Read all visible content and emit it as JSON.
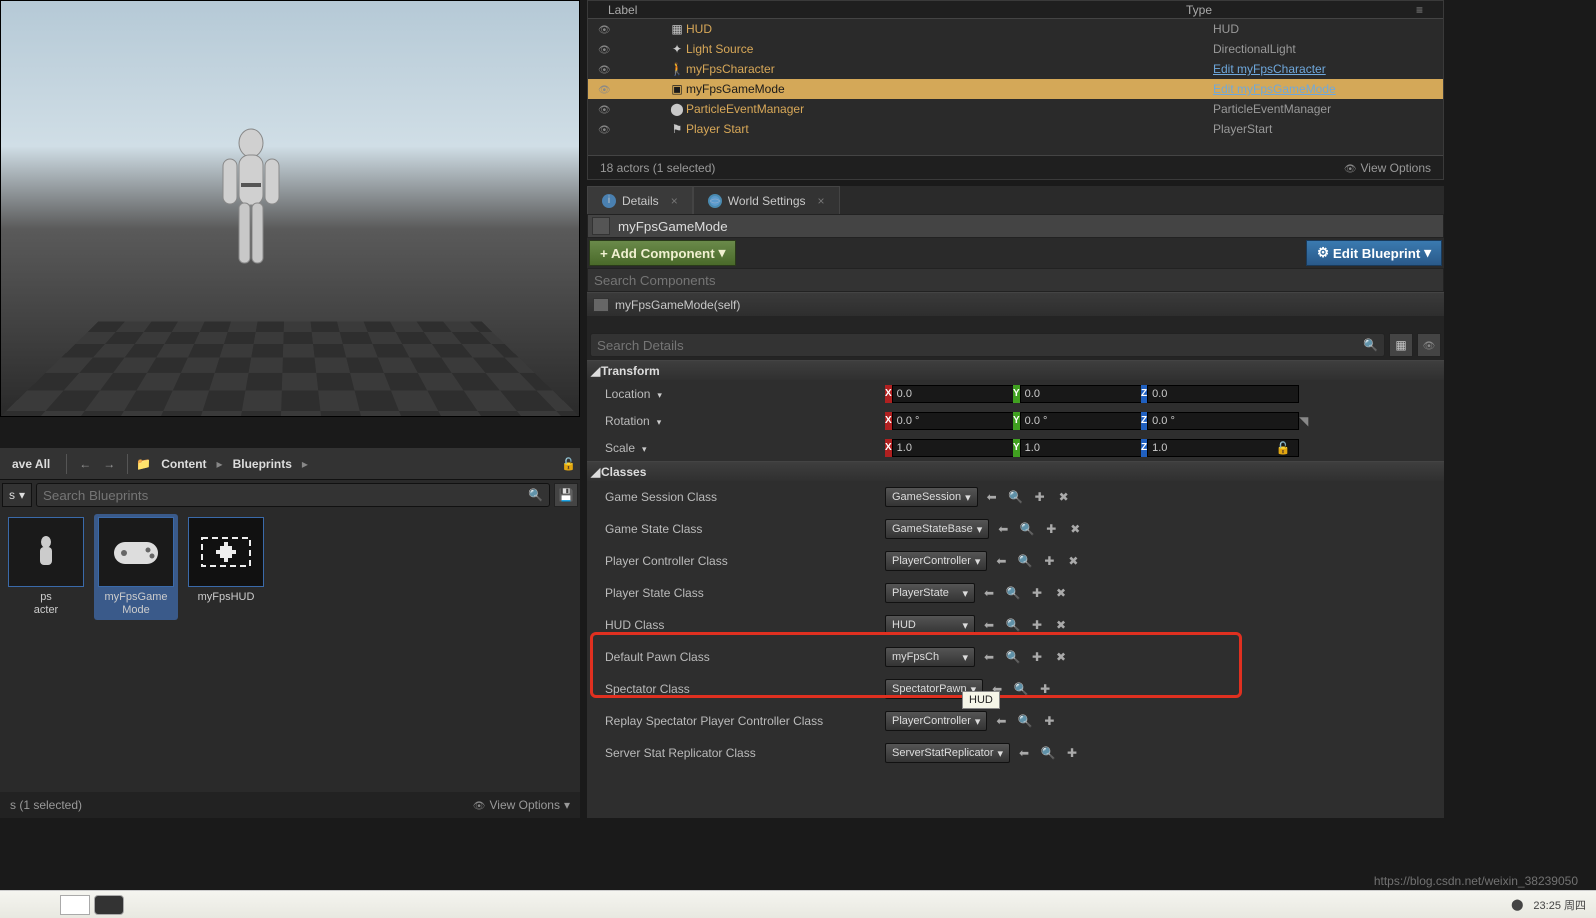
{
  "outliner": {
    "headers": {
      "label": "Label",
      "type": "Type"
    },
    "rows": [
      {
        "label": "HUD",
        "type": "HUD",
        "icon": "hud"
      },
      {
        "label": "Light Source",
        "type": "DirectionalLight",
        "icon": "light"
      },
      {
        "label": "myFpsCharacter",
        "type": "Edit myFpsCharacter",
        "icon": "char",
        "link": true
      },
      {
        "label": "myFpsGameMode",
        "type": "Edit myFpsGameMode",
        "icon": "gm",
        "selected": true,
        "link": true
      },
      {
        "label": "ParticleEventManager",
        "type": "ParticleEventManager",
        "icon": "sphere"
      },
      {
        "label": "Player Start",
        "type": "PlayerStart",
        "icon": "flag"
      }
    ],
    "footer_count": "18 actors (1 selected)",
    "view_options": "View Options"
  },
  "tabs": {
    "details": "Details",
    "world_settings": "World Settings"
  },
  "details": {
    "name": "myFpsGameMode",
    "add_component": "+ Add Component",
    "edit_blueprint": "Edit Blueprint",
    "search_components_ph": "Search Components",
    "component_root": "myFpsGameMode(self)",
    "search_details_ph": "Search Details",
    "transform": {
      "title": "Transform",
      "location_label": "Location",
      "rotation_label": "Rotation",
      "scale_label": "Scale",
      "loc": {
        "x": "0.0",
        "y": "0.0",
        "z": "0.0"
      },
      "rot": {
        "x": "0.0 °",
        "y": "0.0 °",
        "z": "0.0 °"
      },
      "scale": {
        "x": "1.0",
        "y": "1.0",
        "z": "1.0"
      }
    },
    "classes": {
      "title": "Classes",
      "rows": [
        {
          "label": "Game Session Class",
          "value": "GameSession"
        },
        {
          "label": "Game State Class",
          "value": "GameStateBase"
        },
        {
          "label": "Player Controller Class",
          "value": "PlayerController"
        },
        {
          "label": "Player State Class",
          "value": "PlayerState"
        },
        {
          "label": "HUD Class",
          "value": "HUD",
          "highlight": true
        },
        {
          "label": "Default Pawn Class",
          "value": "myFpsCh"
        },
        {
          "label": "Spectator Class",
          "value": "SpectatorPawn"
        },
        {
          "label": "Replay Spectator Player Controller Class",
          "value": "PlayerController"
        },
        {
          "label": "Server Stat Replicator Class",
          "value": "ServerStatReplicator"
        }
      ]
    },
    "tooltip_hud": "HUD"
  },
  "content_browser": {
    "save_all": "ave All",
    "breadcrumb": {
      "root": "Content",
      "sub": "Blueprints"
    },
    "filters_label": "s",
    "search_ph": "Search Blueprints",
    "items": [
      {
        "label": "ps\nacter",
        "thumb": "char"
      },
      {
        "label": "myFpsGame\nMode",
        "thumb": "gamemode",
        "selected": true
      },
      {
        "label": "myFpsHUD",
        "thumb": "hud"
      }
    ],
    "status": "s (1 selected)",
    "view_options": "View Options"
  },
  "taskbar": {
    "time": "23:25 周四"
  },
  "watermark": "https://blog.csdn.net/weixin_38239050"
}
